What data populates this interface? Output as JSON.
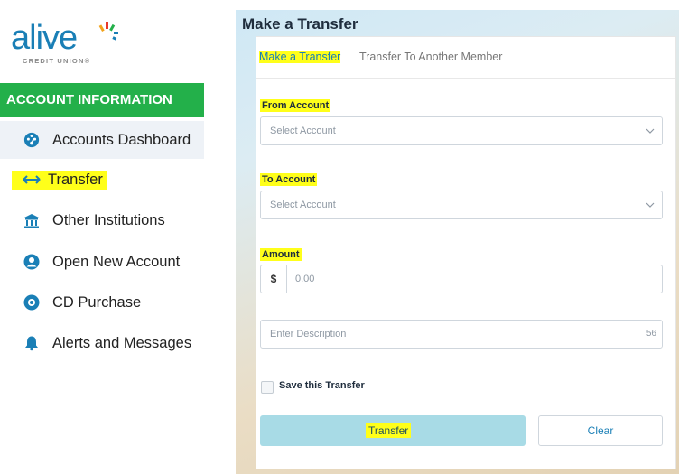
{
  "brand": {
    "name": "alive",
    "subtitle": "CREDIT UNION®"
  },
  "sidebar": {
    "section_header": "ACCOUNT INFORMATION",
    "items": [
      {
        "label": "Accounts Dashboard",
        "icon": "dashboard-gauge-icon"
      },
      {
        "label": "Transfer",
        "icon": "left-right-arrow-icon"
      },
      {
        "label": "Other Institutions",
        "icon": "bank-building-icon"
      },
      {
        "label": "Open New Account",
        "icon": "user-circle-icon"
      },
      {
        "label": "CD Purchase",
        "icon": "cd-disc-icon"
      },
      {
        "label": "Alerts and Messages",
        "icon": "bell-icon"
      }
    ]
  },
  "main": {
    "title": "Make a Transfer",
    "tabs": [
      {
        "label": "Make a Transfer"
      },
      {
        "label": "Transfer To Another Member"
      }
    ],
    "form": {
      "from_label": "From Account",
      "from_placeholder": "Select Account",
      "to_label": "To Account",
      "to_placeholder": "Select Account",
      "amount_label": "Amount",
      "currency_symbol": "$",
      "amount_placeholder": "0.00",
      "description_placeholder": "Enter Description",
      "description_count": "56",
      "save_label": "Save this Transfer",
      "transfer_button": "Transfer",
      "clear_button": "Clear"
    }
  },
  "colors": {
    "brand_blue": "#1a7fb6",
    "section_green": "#23b04a",
    "highlight_yellow": "#ffff1a",
    "transfer_button": "#a8dbe6"
  }
}
